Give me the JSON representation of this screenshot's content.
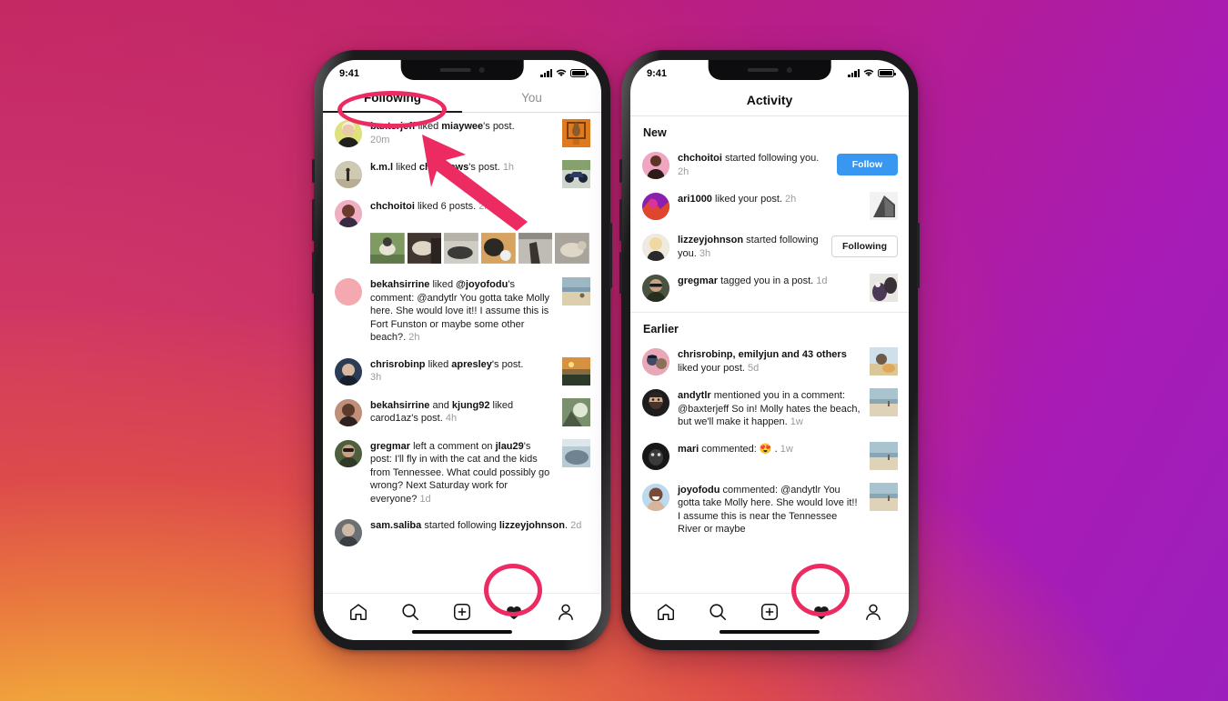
{
  "background": {
    "accent_pink": "#ec2b62",
    "gradient_from": "#f5b942",
    "gradient_mid": "#c2235f",
    "gradient_to": "#9c1fbd"
  },
  "left_phone": {
    "status": {
      "time": "9:41",
      "signal_icon": "cellular-bars-icon",
      "wifi_icon": "wifi-icon",
      "battery_icon": "battery-full-icon"
    },
    "tabs": [
      {
        "label": "Following",
        "active": true
      },
      {
        "label": "You",
        "active": false
      }
    ],
    "items": [
      {
        "user": "baxterjeff",
        "action": " liked ",
        "target": "miaywee",
        "suffix": "'s post.",
        "time": "20m",
        "thumb": "orange-art-thumb"
      },
      {
        "user": "k.m.l",
        "action": " liked ",
        "target": "chrisdows",
        "suffix": "'s post.",
        "time": "1h",
        "thumb": "motorcycle-thumb"
      },
      {
        "user": "chchoitoi",
        "action": " liked 6 posts.",
        "target": "",
        "suffix": "",
        "time": "2h",
        "thumb": "",
        "strip": [
          "dog-grass-thumb",
          "dog-couch-thumb",
          "dog-floor-thumb",
          "dog-ball-thumb",
          "dog-street-thumb",
          "dog-walk-thumb"
        ]
      },
      {
        "user": "bekahsirrine",
        "action": " liked ",
        "target": "@joyofodu",
        "suffix": "'s comment: @andytlr You gotta take Molly here. She would love it!! I assume this is Fort Funston or maybe some other beach?.",
        "time": "2h",
        "thumb": "beach-thumb"
      },
      {
        "user": "chrisrobinp",
        "action": " liked ",
        "target": "apresley",
        "suffix": "'s post.",
        "time": "3h",
        "thumb": "sunset-thumb"
      },
      {
        "user": "bekahsirrine",
        "action": " and ",
        "target": "kjung92",
        "suffix": " liked carod1az's post.",
        "time": "4h",
        "thumb": "drink-thumb"
      },
      {
        "user": "gregmar",
        "action": " left a comment on ",
        "target": "jlau29",
        "suffix": "'s post:  I'll fly in with the cat and the kids from Tennessee. What could possibly go wrong? Next Saturday work for everyone?",
        "time": "1d",
        "thumb": "water-thumb"
      },
      {
        "user": "sam.saliba",
        "action": " started following ",
        "target": "lizzeyjohnson",
        "suffix": ".",
        "time": "2d",
        "thumb": ""
      }
    ],
    "bottom_nav": [
      {
        "icon": "home-icon",
        "active": false
      },
      {
        "icon": "search-icon",
        "active": false
      },
      {
        "icon": "new-post-icon",
        "active": false
      },
      {
        "icon": "heart-icon",
        "active": true
      },
      {
        "icon": "profile-icon",
        "active": false
      }
    ]
  },
  "right_phone": {
    "status": {
      "time": "9:41",
      "signal_icon": "cellular-bars-icon",
      "wifi_icon": "wifi-icon",
      "battery_icon": "battery-full-icon"
    },
    "title": "Activity",
    "sections": [
      {
        "heading": "New",
        "items": [
          {
            "user": "chchoitoi",
            "text": " started following you.",
            "time": "2h",
            "button": "Follow",
            "button_style": "primary",
            "thumb": "",
            "avatar": "pink-portrait-avatar"
          },
          {
            "user": "ari1000",
            "text": " liked your post.",
            "time": "2h",
            "button": "",
            "thumb": "building-thumb",
            "avatar": "magenta-portrait-avatar"
          },
          {
            "user": "lizzeyjohnson",
            "text": " started following you.",
            "time": "3h",
            "button": "Following",
            "button_style": "outline",
            "thumb": "",
            "avatar": "blonde-portrait-avatar"
          },
          {
            "user": "gregmar",
            "text": " tagged you in a post.",
            "time": "1d",
            "button": "",
            "thumb": "dogs-thumb",
            "avatar": "sunglasses-avatar"
          }
        ]
      },
      {
        "heading": "Earlier",
        "items": [
          {
            "user": "chrisrobinp, emilyjun",
            "bold_tail": " and 43 others",
            "text": " liked your post.",
            "time": "5d",
            "button": "",
            "thumb": "burger-thumb",
            "avatar": "group-avatar"
          },
          {
            "user": "andytlr",
            "text": " mentioned you in a comment: @baxterjeff So in! Molly hates the beach, but we'll make it happen.",
            "time": "1w",
            "button": "",
            "thumb": "beach-thumb",
            "avatar": "beard-avatar"
          },
          {
            "user": "mari",
            "text": " commented: 😍 .",
            "time": "1w",
            "button": "",
            "thumb": "beach-thumb",
            "avatar": "dark-avatar"
          },
          {
            "user": "joyofodu",
            "text": " commented: @andytlr You gotta take Molly here. She would love it!! I assume this is near the Tennessee River or maybe",
            "time": "",
            "button": "",
            "thumb": "beach-thumb",
            "avatar": "smiling-avatar"
          }
        ]
      }
    ],
    "bottom_nav": [
      {
        "icon": "home-icon",
        "active": false
      },
      {
        "icon": "search-icon",
        "active": false
      },
      {
        "icon": "new-post-icon",
        "active": false
      },
      {
        "icon": "heart-icon",
        "active": true
      },
      {
        "icon": "profile-icon",
        "active": false
      }
    ]
  },
  "annotations": [
    {
      "type": "ellipse",
      "target": "following-tab"
    },
    {
      "type": "arrow",
      "target": "following-tab"
    },
    {
      "type": "ellipse",
      "target": "left-heart-nav-icon"
    },
    {
      "type": "ellipse",
      "target": "right-heart-nav-icon"
    }
  ]
}
